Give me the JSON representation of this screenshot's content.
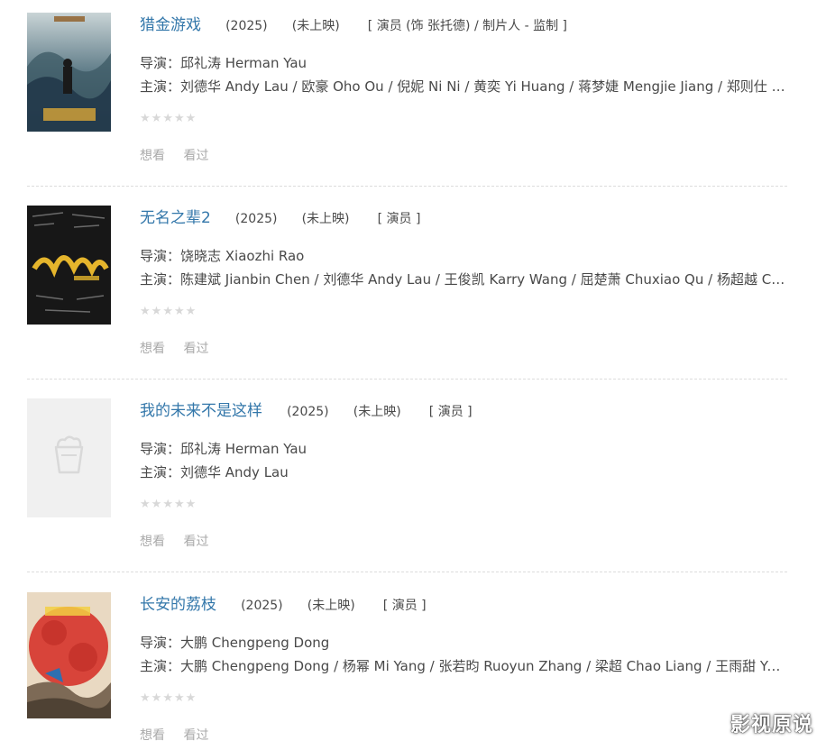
{
  "colors": {
    "title": "#3377aa",
    "text": "#494949",
    "muted": "#aaaaaa",
    "star_off": "#d8d8d8"
  },
  "movies": [
    {
      "title": "猎金游戏",
      "year": "(2025)",
      "status": "(未上映)",
      "role": "[ 演员 (饰 张托德) / 制片人 - 监制 ]",
      "director": "导演：邱礼涛 Herman Yau",
      "cast": "主演：刘德华 Andy Lau / 欧豪 Oho Ou / 倪妮 Ni Ni / 黄奕 Yi Huang / 蒋梦婕 Mengjie Jiang / 郑则仕 Kent Cheng",
      "want": "想看",
      "seen": "看过"
    },
    {
      "title": "无名之辈2",
      "year": "(2025)",
      "status": "(未上映)",
      "role": "[ 演员 ]",
      "director": "导演：饶晓志 Xiaozhi Rao",
      "cast": "主演：陈建斌 Jianbin Chen / 刘德华 Andy Lau / 王俊凯 Karry Wang / 屈楚萧 Chuxiao Qu / 杨超越 Chaoyue Yang",
      "want": "想看",
      "seen": "看过"
    },
    {
      "title": "我的未来不是这样",
      "year": "(2025)",
      "status": "(未上映)",
      "role": "[ 演员 ]",
      "director": "导演：邱礼涛 Herman Yau",
      "cast": "主演：刘德华 Andy Lau",
      "want": "想看",
      "seen": "看过"
    },
    {
      "title": "长安的荔枝",
      "year": "(2025)",
      "status": "(未上映)",
      "role": "[ 演员 ]",
      "director": "导演：大鹏 Chengpeng Dong",
      "cast": "主演：大鹏 Chengpeng Dong / 杨幂 Mi Yang / 张若昀 Ruoyun Zhang / 梁超 Chao Liang / 王雨甜 Yutian Wang",
      "want": "想看",
      "seen": "看过"
    }
  ],
  "watermark": "影视原说"
}
